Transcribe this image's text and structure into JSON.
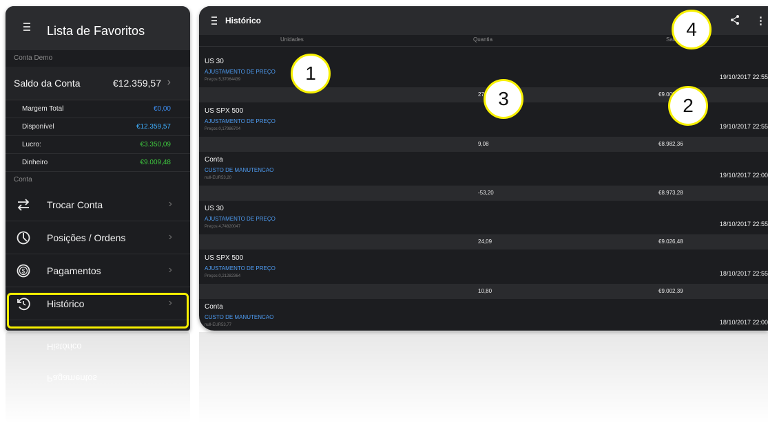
{
  "left_panel": {
    "title": "Lista de Favoritos",
    "section_account": "Conta Demo",
    "saldo_label": "Saldo da Conta",
    "saldo_value": "€12.359,57",
    "metrics": [
      {
        "label": "Margem Total",
        "value": "€0,00",
        "color": "#3d8df0"
      },
      {
        "label": "Disponível",
        "value": "€12.359,57",
        "color": "#3fb0ff"
      },
      {
        "label": "Lucro:",
        "value": "€3.350,09",
        "color": "#3fc93f"
      },
      {
        "label": "Dinheiro",
        "value": "€9.009,48",
        "color": "#3fc93f"
      }
    ],
    "section_conta": "Conta",
    "nav": [
      {
        "label": "Trocar Conta",
        "icon": "swap-arrows-icon"
      },
      {
        "label": "Posições / Ordens",
        "icon": "clock-pie-icon"
      },
      {
        "label": "Pagamentos",
        "icon": "dollar-coin-icon"
      },
      {
        "label": "Histórico",
        "icon": "history-icon"
      }
    ],
    "highlight_color": "#f7f000"
  },
  "right_panel": {
    "title": "Histórico",
    "columns": [
      "Unidades",
      "Quantia",
      "Saldo"
    ],
    "entries": [
      {
        "title": "US 30",
        "type": "AJUSTAMENTO DE PREÇO",
        "sub": "Preços:5,37064439",
        "date": "19/10/2017 22:55",
        "qty": "27,12",
        "balance": "€9.009,48"
      },
      {
        "title": "US SPX 500",
        "type": "AJUSTAMENTO DE PREÇO",
        "sub": "Preços:0,17986704",
        "date": "19/10/2017 22:55",
        "qty": "9,08",
        "balance": "€8.982,36"
      },
      {
        "title": "Conta",
        "type": "CUSTO DE MANUTENCAO",
        "sub": "null-EUR53,20",
        "date": "19/10/2017 22:00",
        "qty": "-53,20",
        "balance": "€8.973,28"
      },
      {
        "title": "US 30",
        "type": "AJUSTAMENTO DE PREÇO",
        "sub": "Preços:4,74820047",
        "date": "18/10/2017 22:55",
        "qty": "24,09",
        "balance": "€9.026,48"
      },
      {
        "title": "US SPX 500",
        "type": "AJUSTAMENTO DE PREÇO",
        "sub": "Preços:0,21282364",
        "date": "18/10/2017 22:55",
        "qty": "10,80",
        "balance": "€9.002,39"
      },
      {
        "title": "Conta",
        "type": "CUSTO DE MANUTENCAO",
        "sub": "null-EUR53,77",
        "date": "18/10/2017 22:00",
        "qty": "",
        "balance": ""
      }
    ]
  },
  "callouts": [
    "1",
    "2",
    "3",
    "4"
  ],
  "reflection": {
    "nav": [
      "Histórico",
      "Pagamentos"
    ]
  }
}
